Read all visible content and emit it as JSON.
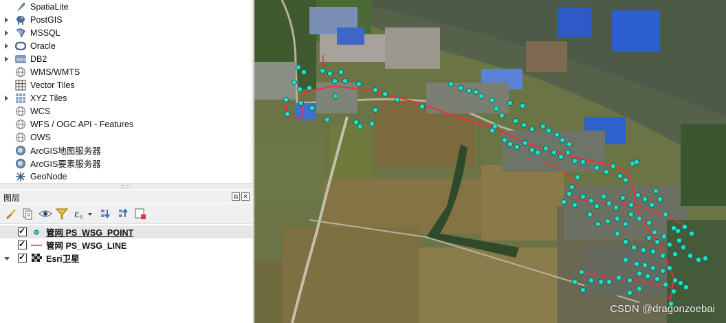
{
  "browser": {
    "items": [
      {
        "label": "SpatiaLite",
        "icon": "feather-icon",
        "expander": "none"
      },
      {
        "label": "PostGIS",
        "icon": "elephant-icon",
        "expander": "right"
      },
      {
        "label": "MSSQL",
        "icon": "mssql-icon",
        "expander": "right"
      },
      {
        "label": "Oracle",
        "icon": "oracle-icon",
        "expander": "right"
      },
      {
        "label": "DB2",
        "icon": "db2-icon",
        "expander": "right"
      },
      {
        "label": "WMS/WMTS",
        "icon": "globe-icon",
        "expander": "none"
      },
      {
        "label": "Vector Tiles",
        "icon": "grid-icon",
        "expander": "none"
      },
      {
        "label": "XYZ Tiles",
        "icon": "xyz-grid-icon",
        "expander": "right"
      },
      {
        "label": "WCS",
        "icon": "globe-icon",
        "expander": "none"
      },
      {
        "label": "WFS / OGC API - Features",
        "icon": "globe-icon",
        "expander": "none"
      },
      {
        "label": "OWS",
        "icon": "globe-icon",
        "expander": "none"
      },
      {
        "label": "ArcGIS地图服务器",
        "icon": "arcgis-globe-icon",
        "expander": "none"
      },
      {
        "label": "ArcGIS要素服务器",
        "icon": "arcgis-globe-icon",
        "expander": "none"
      },
      {
        "label": "GeoNode",
        "icon": "geonode-icon",
        "expander": "none"
      }
    ]
  },
  "layers_panel": {
    "title": "图层",
    "float_button": "⧉",
    "close_button": "✕",
    "toolbar": [
      "style-manager-icon",
      "add-group-icon",
      "visibility-eye-icon",
      "filter-icon",
      "expression-filter-icon",
      "expand-all-icon",
      "collapse-all-icon",
      "remove-layer-icon"
    ],
    "layers": [
      {
        "name": "管网 PS_WSG_POINT",
        "checked": true,
        "symbol": "point",
        "selected": true
      },
      {
        "name": "管网 PS_WSG_LINE",
        "checked": true,
        "symbol": "line",
        "selected": false
      },
      {
        "name": "Esri卫星",
        "checked": true,
        "symbol": "raster",
        "selected": false
      }
    ]
  },
  "colors": {
    "point_fill": "#22e0c8",
    "point_stroke": "#0a6b5e",
    "line_color": "#e8323c"
  },
  "map": {
    "watermark": "CSDN @dragonzoebai"
  }
}
